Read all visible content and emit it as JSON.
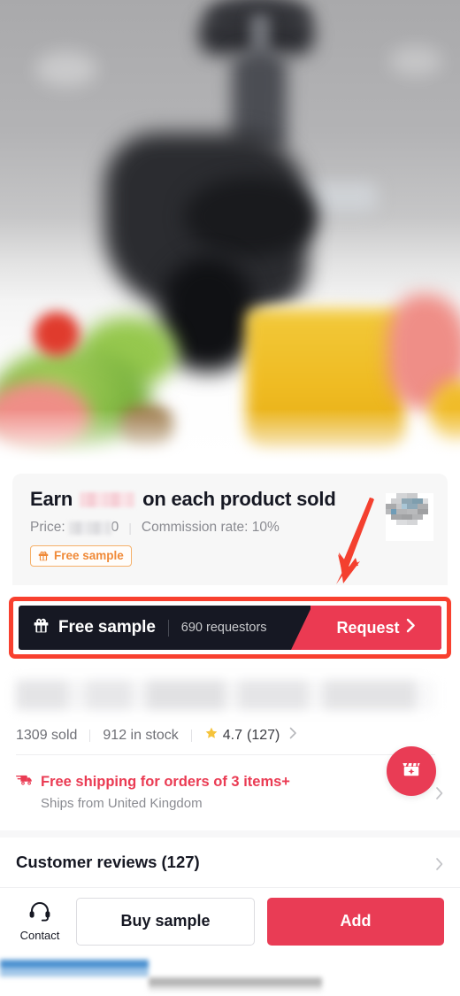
{
  "hero": {
    "alt": "blurred-product-photo-juicer-with-fruit-and-vegetables"
  },
  "earn_card": {
    "headline_prefix": "Earn",
    "headline_suffix": "on each product sold",
    "earn_amount_redacted": true,
    "price_label": "Price:",
    "price_value_visible_tail": "0",
    "price_value_redacted": true,
    "separator": "|",
    "commission_label": "Commission rate: 10%",
    "commission_rate": "10%",
    "badge_label": "Free sample",
    "badge_icon": "gift-icon",
    "qr_icon": "pixelated-qr-code"
  },
  "annotation": {
    "arrow_color": "#f4402f",
    "highlight_border_color": "#f8402f",
    "points_to": "free-sample-banner"
  },
  "free_sample_banner": {
    "icon": "gift-icon",
    "title": "Free sample",
    "divider": "|",
    "requestors": "690 requestors",
    "requestor_count": 690,
    "cta_label": "Request",
    "cta_icon": "chevron-right-icon",
    "bg_color": "#161823",
    "cta_color": "#eb3a52"
  },
  "product": {
    "title_redacted": true,
    "sold": "1309 sold",
    "sold_count": 1309,
    "stock": "912 in stock",
    "stock_count": 912,
    "rating_value": "4.7",
    "rating_count": "(127)",
    "star_icon": "star-icon",
    "chevron_icon": "chevron-right-icon"
  },
  "shipping": {
    "icon": "delivery-truck-icon",
    "headline": "Free shipping for orders of 3 items+",
    "min_items": 3,
    "origin": "Ships from United Kingdom",
    "chevron_icon": "chevron-right-icon",
    "accent_color": "#ea3b53"
  },
  "shop_fab": {
    "icon": "shop-store-icon",
    "bg_color": "#e93c55"
  },
  "reviews": {
    "title": "Customer reviews (127)",
    "count": 127,
    "chevron_icon": "chevron-right-icon"
  },
  "action_bar": {
    "contact_label": "Contact",
    "contact_icon": "headset-icon",
    "buy_sample_label": "Buy sample",
    "add_label": "Add",
    "add_bg_color": "#e93c55"
  },
  "system_bar": {
    "blurred_blue_strip": true,
    "blurred_gray_strip": true
  }
}
